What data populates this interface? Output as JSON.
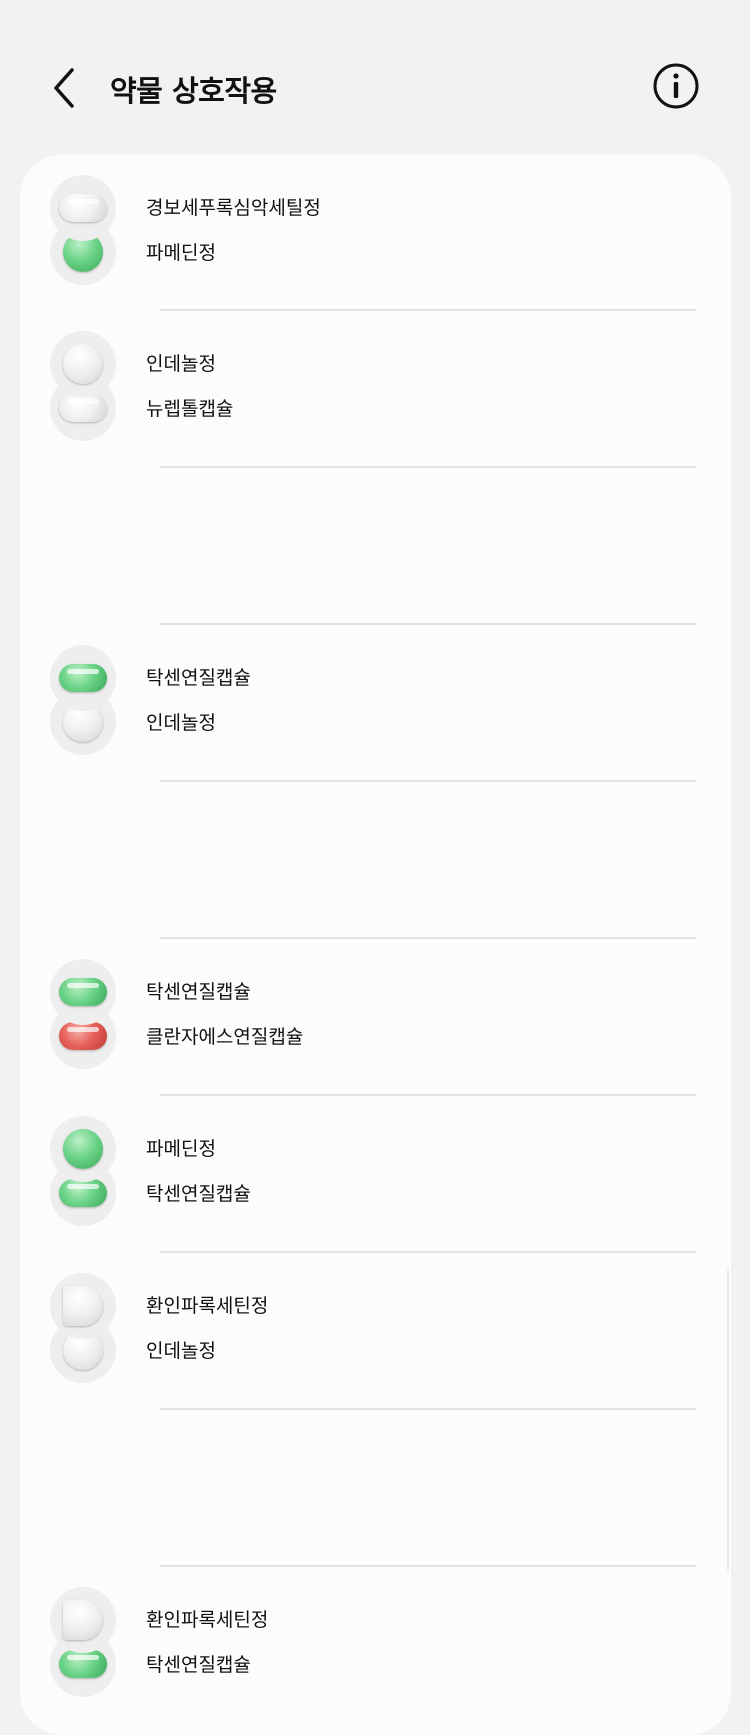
{
  "header": {
    "title": "약물 상호작용",
    "back_icon": "chevron-left-icon",
    "info_icon": "info-circle-icon"
  },
  "interactions": [
    {
      "drugs": [
        {
          "name": "경보세푸록심악세틸정",
          "pill": "white-capsule"
        },
        {
          "name": "파메딘정",
          "pill": "green-round"
        }
      ]
    },
    {
      "drugs": [
        {
          "name": "인데놀정",
          "pill": "white-round"
        },
        {
          "name": "뉴렙톨캡슐",
          "pill": "white-capsule"
        }
      ]
    },
    {
      "drugs": [
        {
          "name": "탁센연질캡슐",
          "pill": "green-capsule"
        },
        {
          "name": "인데놀정",
          "pill": "white-round"
        }
      ]
    },
    {
      "drugs": [
        {
          "name": "탁센연질캡슐",
          "pill": "green-capsule"
        },
        {
          "name": "클란자에스연질캡슐",
          "pill": "red-capsule"
        }
      ]
    },
    {
      "drugs": [
        {
          "name": "파메딘정",
          "pill": "green-round"
        },
        {
          "name": "탁센연질캡슐",
          "pill": "green-capsule"
        }
      ]
    },
    {
      "drugs": [
        {
          "name": "환인파록세틴정",
          "pill": "white-d-shaped"
        },
        {
          "name": "인데놀정",
          "pill": "white-round"
        }
      ]
    },
    {
      "drugs": [
        {
          "name": "환인파록세틴정",
          "pill": "white-d-shaped"
        },
        {
          "name": "탁센연질캡슐",
          "pill": "green-capsule"
        }
      ]
    }
  ],
  "colors": {
    "page_bg": "#f2f2f4",
    "card_bg": "#fcfcfe",
    "pill_green": "#6cd488",
    "pill_red": "#e6615a",
    "pill_white": "#f1f1f1"
  }
}
